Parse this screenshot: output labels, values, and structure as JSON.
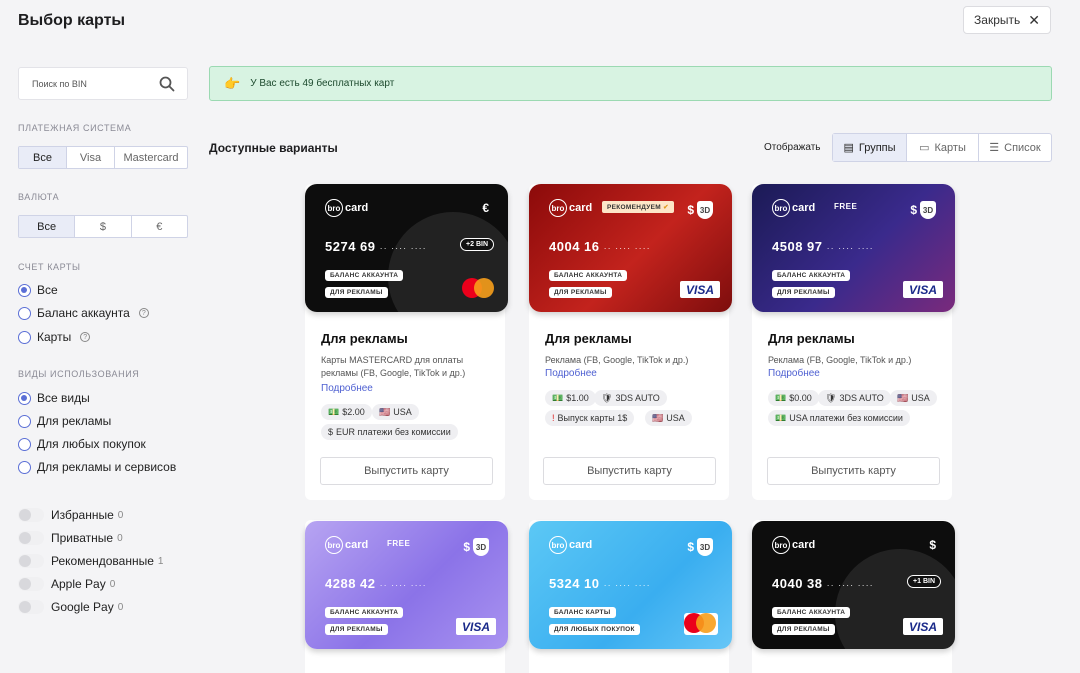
{
  "header": {
    "title": "Выбор карты",
    "close_label": "Закрыть"
  },
  "sidebar": {
    "search_placeholder": "Поиск по BIN",
    "payment_label": "ПЛАТЕЖНАЯ СИСТЕМА",
    "payment_options": [
      "Все",
      "Visa",
      "Mastercard"
    ],
    "currency_label": "ВАЛЮТА",
    "currency_options": [
      "Все",
      "$",
      "€"
    ],
    "account_label": "СЧЕТ КАРТЫ",
    "account_options": [
      "Все",
      "Баланс аккаунта",
      "Карты"
    ],
    "usage_label": "ВИДЫ ИСПОЛЬЗОВАНИЯ",
    "usage_options": [
      "Все виды",
      "Для рекламы",
      "Для любых покупок",
      "Для рекламы и сервисов"
    ],
    "toggles": [
      {
        "label": "Избранные",
        "count": "0"
      },
      {
        "label": "Приватные",
        "count": "0"
      },
      {
        "label": "Рекомендованные",
        "count": "1"
      },
      {
        "label": "Apple Pay",
        "count": "0"
      },
      {
        "label": "Google Pay",
        "count": "0"
      }
    ]
  },
  "banner": {
    "text": "У Вас есть 49 бесплатных карт"
  },
  "main": {
    "available_label": "Доступные варианты",
    "display_label": "Отображать",
    "views": [
      "Группы",
      "Карты",
      "Список"
    ]
  },
  "cards": [
    {
      "brand": "bro",
      "brand2": "card",
      "currency": "€",
      "number": "5274 69",
      "dots": "·· ···· ····",
      "bin": "+2 BIN",
      "pill1": "БАЛАНС АККАУНТА",
      "pill2": "ДЛЯ РЕКЛАМЫ",
      "title": "Для рекламы",
      "desc": "Карты MASTERCARD для оплаты рекламы (FB, Google, TikTok и др.)",
      "more": "Подробнее",
      "tags": [
        "$2.00",
        "USA",
        "EUR платежи без комиссии"
      ],
      "button": "Выпустить карту"
    },
    {
      "brand": "bro",
      "brand2": "card",
      "recommended": "РЕКОМЕНДУЕМ",
      "currency": "$",
      "badge": "3D",
      "number": "4004 16",
      "dots": "·· ···· ····",
      "pill1": "БАЛАНС АККАУНТА",
      "pill2": "ДЛЯ РЕКЛАМЫ",
      "visa": "VISA",
      "title": "Для рекламы",
      "desc": "Реклама (FB, Google, TikTok и др.)",
      "more": "Подробнее",
      "tags": [
        "$1.00",
        "3DS AUTO",
        "Выпуск карты 1$",
        "USA"
      ],
      "button": "Выпустить карту"
    },
    {
      "brand": "bro",
      "brand2": "card",
      "free": "FREE",
      "currency": "$",
      "badge": "3D",
      "number": "4508 97",
      "dots": "·· ···· ····",
      "pill1": "БАЛАНС АККАУНТА",
      "pill2": "ДЛЯ РЕКЛАМЫ",
      "visa": "VISA",
      "title": "Для рекламы",
      "desc": "Реклама (FB, Google, TikTok и др.)",
      "more": "Подробнее",
      "tags": [
        "$0.00",
        "3DS AUTO",
        "USA",
        "USA платежи без комиссии"
      ],
      "button": "Выпустить карту"
    },
    {
      "brand": "bro",
      "brand2": "card",
      "free": "FREE",
      "currency": "$",
      "badge": "3D",
      "number": "4288 42",
      "dots": "·· ···· ····",
      "pill1": "БАЛАНС АККАУНТА",
      "pill2": "ДЛЯ РЕКЛАМЫ",
      "visa": "VISA"
    },
    {
      "brand": "bro",
      "brand2": "card",
      "currency": "$",
      "badge": "3D",
      "number": "5324 10",
      "dots": "·· ···· ····",
      "pill1": "БАЛАНС КАРТЫ",
      "pill2": "ДЛЯ ЛЮБЫХ ПОКУПОК"
    },
    {
      "brand": "bro",
      "brand2": "card",
      "currency": "$",
      "number": "4040 38",
      "dots": "·· ···· ····",
      "bin": "+1 BIN",
      "pill1": "БАЛАНС АККАУНТА",
      "pill2": "ДЛЯ РЕКЛАМЫ",
      "visa": "VISA"
    }
  ],
  "colors": {
    "accent": "#5b6fd6",
    "banner_bg": "#d8f3e2",
    "link": "#4d5fd1"
  }
}
